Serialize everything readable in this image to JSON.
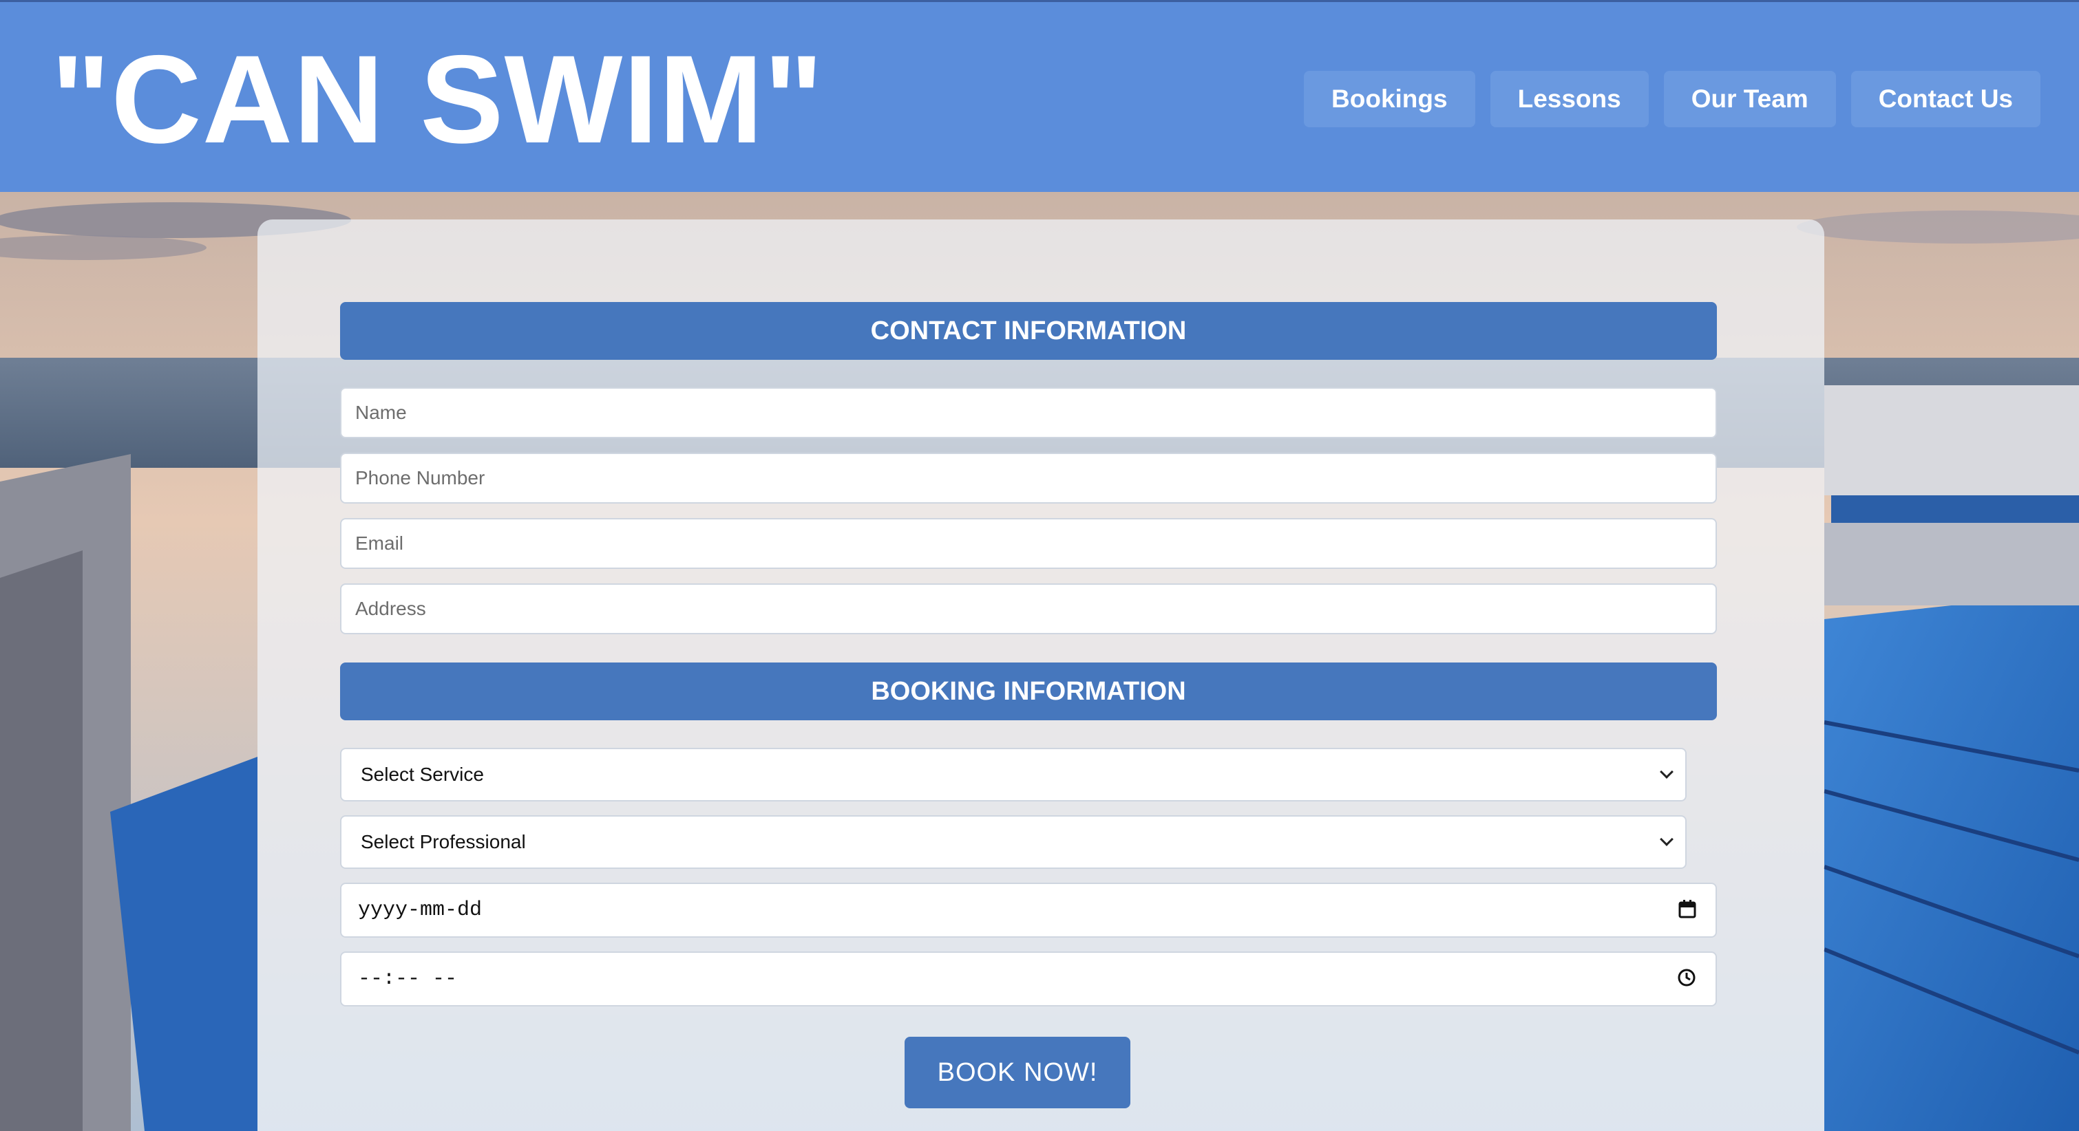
{
  "header": {
    "logo": "\"CAN SWIM\"",
    "nav": [
      {
        "label": "Bookings"
      },
      {
        "label": "Lessons"
      },
      {
        "label": "Our Team"
      },
      {
        "label": "Contact Us"
      }
    ]
  },
  "contact": {
    "heading": "CONTACT INFORMATION",
    "name_placeholder": "Name",
    "phone_placeholder": "Phone Number",
    "email_placeholder": "Email",
    "address_placeholder": "Address"
  },
  "booking": {
    "heading": "BOOKING INFORMATION",
    "service_selected": "Select Service",
    "professional_selected": "Select Professional",
    "date_placeholder": "yyyy-mm-dd",
    "time_placeholder": "--:-- --",
    "submit_label": "BOOK NOW!"
  },
  "colors": {
    "header_bg": "#5b8ddb",
    "nav_button_bg": "#6a99e0",
    "section_bar_bg": "#4677bd",
    "submit_bg": "#4677bd"
  },
  "icons": {
    "select_arrow": "chevron-down-icon",
    "date_picker": "calendar-icon",
    "time_picker": "clock-icon"
  }
}
